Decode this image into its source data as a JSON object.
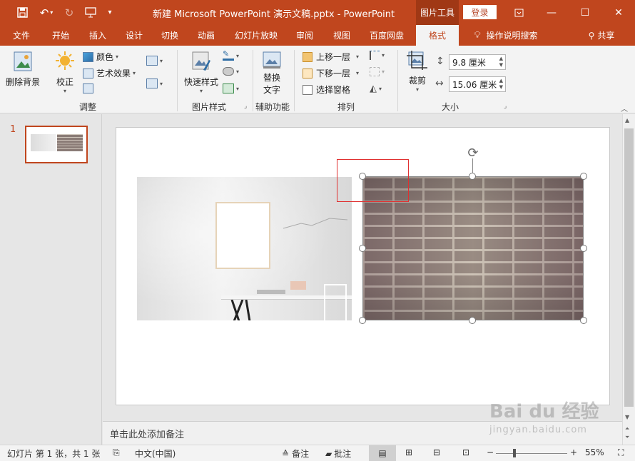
{
  "titlebar": {
    "title": "新建 Microsoft PowerPoint 演示文稿.pptx  -  PowerPoint",
    "context_tab": "图片工具",
    "login_label": "登录",
    "qat_icons": [
      "save-icon",
      "undo-icon",
      "redo-icon",
      "present-icon",
      "customize-icon"
    ],
    "window_icons": [
      "ribbon-display-icon",
      "minimize-icon",
      "maximize-icon",
      "close-icon"
    ]
  },
  "tabs": [
    "文件",
    "开始",
    "插入",
    "设计",
    "切换",
    "动画",
    "幻灯片放映",
    "审阅",
    "视图",
    "百度网盘",
    "格式"
  ],
  "active_tab": "格式",
  "tellme": "操作说明搜索",
  "share": "共享",
  "ribbon": {
    "remove_bg": "删除背景",
    "corrections": "校正",
    "color": "颜色",
    "artistic": "艺术效果",
    "group_adjust": "调整",
    "quick_styles": "快速样式",
    "group_picstyles": "图片样式",
    "alt_text_line1": "替换",
    "alt_text_line2": "文字",
    "group_accessibility": "辅助功能",
    "bring_forward": "上移一层",
    "send_backward": "下移一层",
    "selection_pane": "选择窗格",
    "group_arrange": "排列",
    "crop": "裁剪",
    "height": "9.8 厘米",
    "width": "15.06 厘米",
    "group_size": "大小"
  },
  "thumbnails": [
    {
      "number": "1"
    }
  ],
  "notes_placeholder": "单击此处添加备注",
  "status": {
    "slide_info": "幻灯片 第 1 张，共 1 张",
    "language": "中文(中国)",
    "notes": "备注",
    "comments": "批注",
    "zoom_minus": "−",
    "zoom_plus": "+",
    "zoom": "55%"
  },
  "watermark": {
    "brand": "Bai du 经验",
    "url": "jingyan.baidu.com"
  },
  "colors": {
    "accent": "#c0461e",
    "selection_box": "#e03030"
  }
}
